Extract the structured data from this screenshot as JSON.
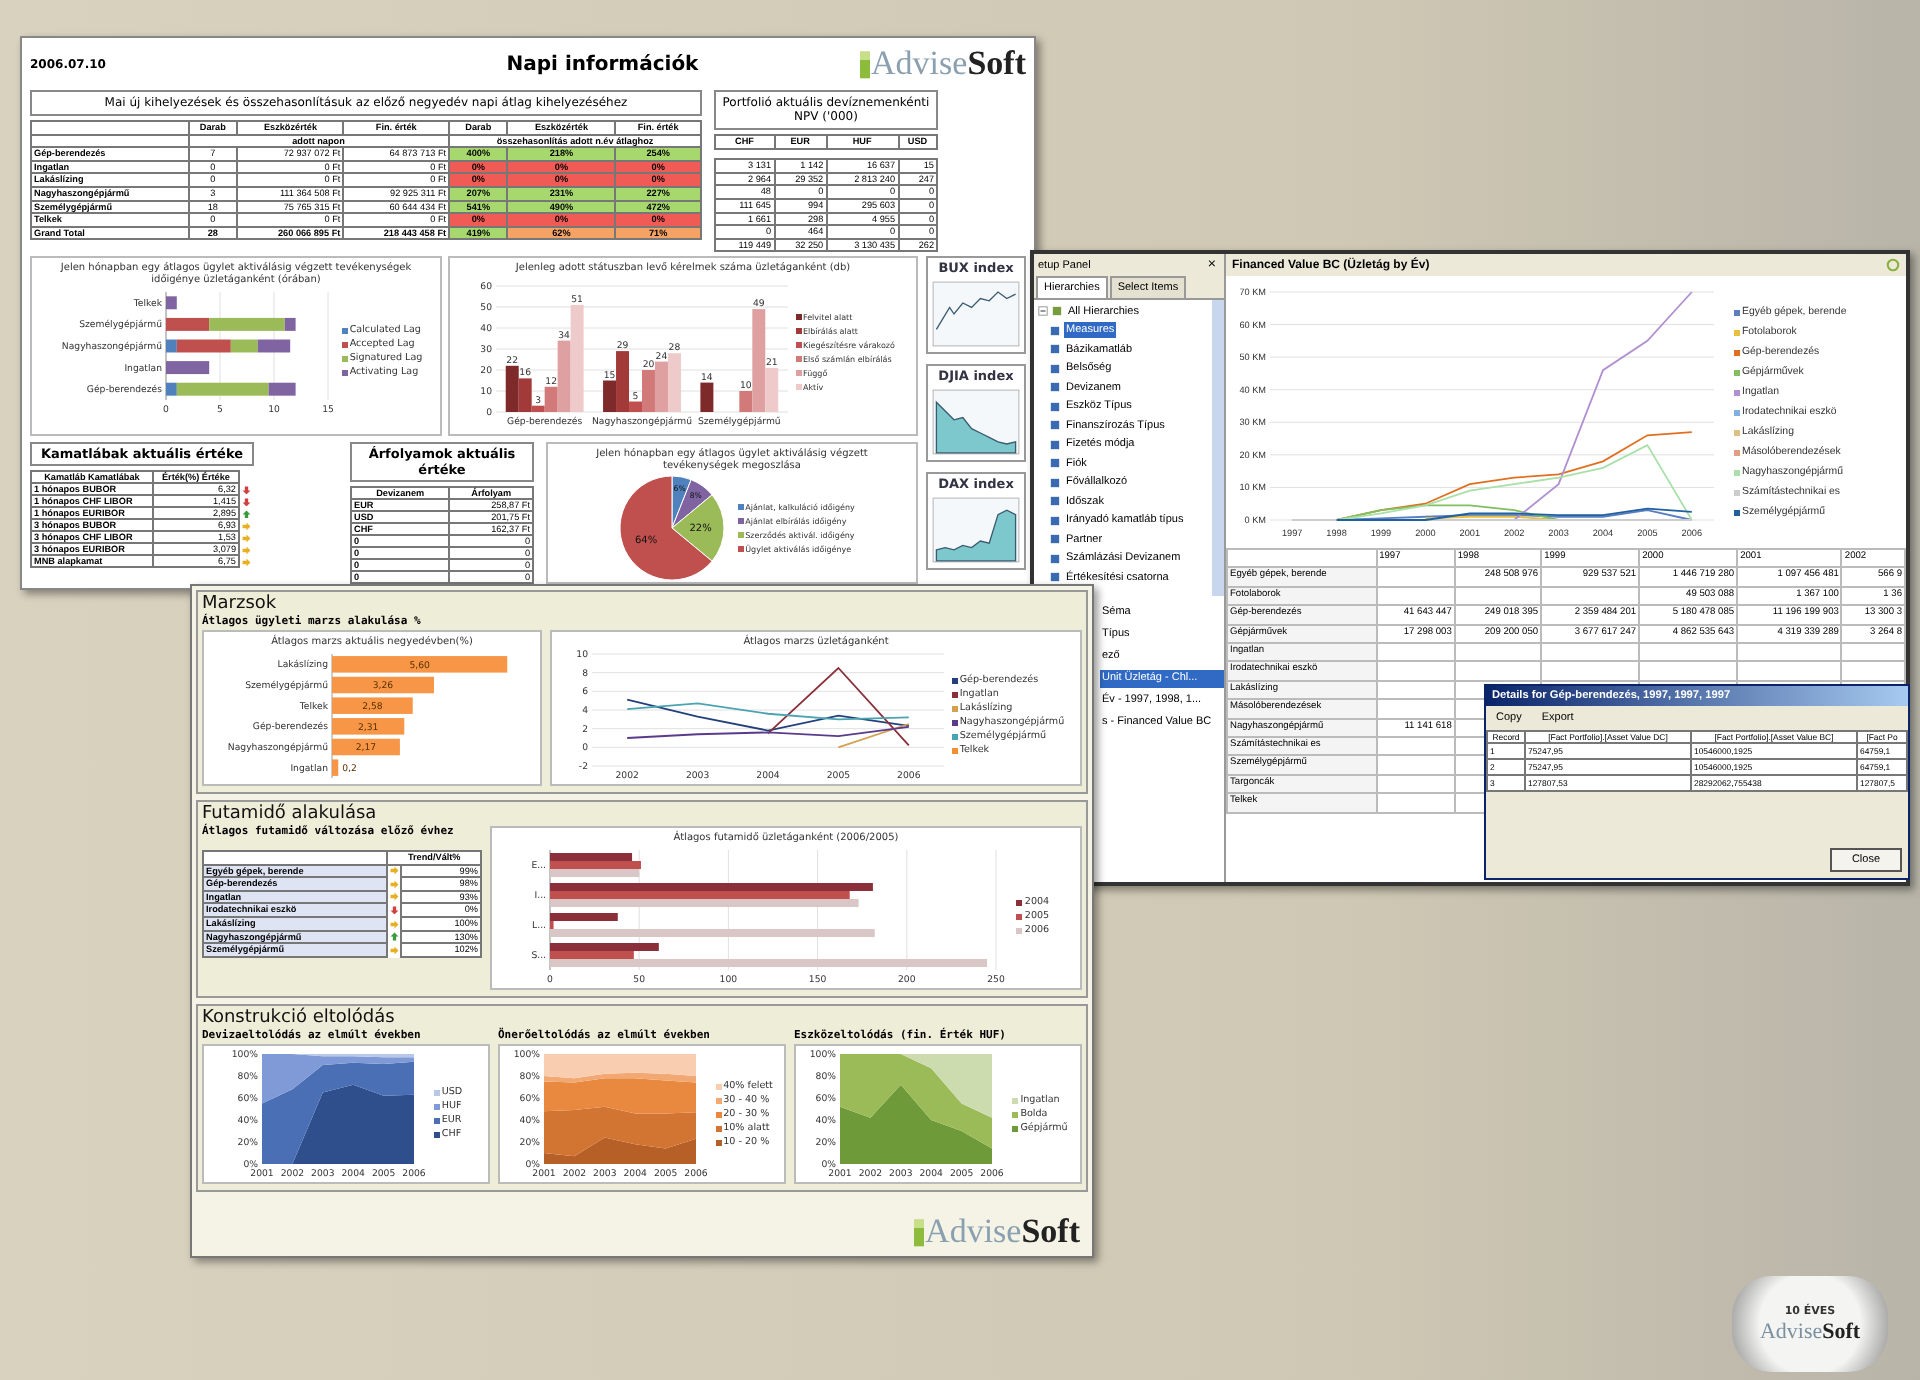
{
  "report": {
    "date": "2006.07.10",
    "title": "Napi információk",
    "logo": "Advise**Soft**",
    "summary": {
      "title": "Mai új kihelyezések és összehasonlításuk az előző negyedév napi átlag kihelyezéséhez",
      "columns": [
        "Darab",
        "Eszközérték",
        "Fin. érték",
        "Darab",
        "Eszközérték",
        "Fin. érték"
      ],
      "groups": [
        "adott napon",
        "összehasonlítás adott n.év átlaghoz"
      ],
      "rows": [
        {
          "label": "Gép-berendezés",
          "kind": "row",
          "count": "7",
          "asset": "72 937 072 Ft",
          "fin": "64 873 713 Ft",
          "compare": [
            {
              "text": "400%",
              "color": "#a6d86e"
            },
            {
              "text": "218%",
              "color": "#a6d86e"
            },
            {
              "text": "254%",
              "color": "#a6d86e"
            }
          ]
        },
        {
          "label": "Ingatlan",
          "kind": "row",
          "count": "0",
          "asset": "0 Ft",
          "fin": "0 Ft",
          "compare": [
            {
              "text": "0%",
              "color": "#f05b55"
            },
            {
              "text": "0%",
              "color": "#f05b55"
            },
            {
              "text": "0%",
              "color": "#f05b55"
            }
          ]
        },
        {
          "label": "Lakáslízing",
          "kind": "row",
          "count": "0",
          "asset": "0 Ft",
          "fin": "0 Ft",
          "compare": [
            {
              "text": "0%",
              "color": "#f05b55"
            },
            {
              "text": "0%",
              "color": "#f05b55"
            },
            {
              "text": "0%",
              "color": "#f05b55"
            }
          ]
        },
        {
          "label": "Nagyhaszongépjármű",
          "kind": "row",
          "count": "3",
          "asset": "111 364 508 Ft",
          "fin": "92 925 311 Ft",
          "compare": [
            {
              "text": "207%",
              "color": "#a6d86e"
            },
            {
              "text": "231%",
              "color": "#a6d86e"
            },
            {
              "text": "227%",
              "color": "#a6d86e"
            }
          ]
        },
        {
          "label": "Személygépjármű",
          "kind": "row",
          "count": "18",
          "asset": "75 765 315 Ft",
          "fin": "60 644 434 Ft",
          "compare": [
            {
              "text": "541%",
              "color": "#a6d86e"
            },
            {
              "text": "490%",
              "color": "#a6d86e"
            },
            {
              "text": "472%",
              "color": "#a6d86e"
            }
          ]
        },
        {
          "label": "Telkek",
          "kind": "row",
          "count": "0",
          "asset": "0 Ft",
          "fin": "0 Ft",
          "compare": [
            {
              "text": "0%",
              "color": "#f05b55"
            },
            {
              "text": "0%",
              "color": "#f05b55"
            },
            {
              "text": "0%",
              "color": "#f05b55"
            }
          ]
        },
        {
          "label": "Grand Total",
          "kind": "total",
          "count": "28",
          "asset": "260 066 895 Ft",
          "fin": "218 443 458 Ft",
          "compare": [
            {
              "text": "419%",
              "color": "#a6d86e"
            },
            {
              "text": "62%",
              "color": "#f5a365"
            },
            {
              "text": "71%",
              "color": "#f5a365"
            }
          ]
        }
      ]
    },
    "npv": {
      "title": "Portfolió aktuális devíznemenkénti NPV ('000)",
      "columns": [
        "CHF",
        "EUR",
        "HUF",
        "USD"
      ],
      "rows": [
        [
          "3 131",
          "1 142",
          "16 637",
          "15"
        ],
        [
          "2 964",
          "29 352",
          "2 813 240",
          "247"
        ],
        [
          "48",
          "0",
          "0",
          "0"
        ],
        [
          "111 645",
          "994",
          "295 603",
          "0"
        ],
        [
          "1 661",
          "298",
          "4 955",
          "0"
        ],
        [
          "0",
          "464",
          "0",
          "0"
        ],
        [
          "119 449",
          "32 250",
          "3 130 435",
          "262"
        ]
      ]
    },
    "lag_chart": {
      "chart_data": {
        "type": "bar",
        "orientation": "horizontal",
        "stacked": true,
        "grid": true,
        "title": "Jelen hónapban egy átlagos ügylet aktiválásig végzett tevékenységek időigénye üzletáganként (órában)",
        "categories": [
          "Telkek",
          "Személygépjármű",
          "Nagyhaszongépjármű",
          "Ingatlan",
          "Gép-berendezés"
        ],
        "xlim": [
          0,
          15
        ],
        "xticks": [
          0,
          5,
          10,
          15
        ],
        "series": [
          {
            "name": "Calculated Lag",
            "color": "#4f81bd",
            "values": [
              0,
              0,
              1,
              0,
              1
            ]
          },
          {
            "name": "Accepted Lag",
            "color": "#c0504d",
            "values": [
              0,
              4,
              5,
              0,
              0
            ]
          },
          {
            "name": "Signatured Lag",
            "color": "#9bbb59",
            "values": [
              0,
              7,
              2.5,
              0,
              8.5
            ]
          },
          {
            "name": "Activating Lag",
            "color": "#8064a2",
            "values": [
              1,
              1,
              3,
              4,
              2.5
            ]
          }
        ]
      }
    },
    "status_chart": {
      "chart_data": {
        "type": "bar",
        "grid": true,
        "title": "Jelenleg adott státuszban levő kérelmek száma üzletáganként (db)",
        "categories": [
          "Gép-berendezés",
          "Nagyhaszongépjármű",
          "Személygépjármű"
        ],
        "ylim": [
          0,
          60
        ],
        "yticks": [
          0,
          10,
          20,
          30,
          40,
          50,
          60
        ],
        "data_labels": true,
        "series": [
          {
            "name": "Felvitel alatt",
            "color": "#7f2a2a",
            "values": [
              22,
              15,
              14
            ]
          },
          {
            "name": "Elbírálás alatt",
            "color": "#a33a3a",
            "values": [
              16,
              29,
              null
            ]
          },
          {
            "name": "Kiegészítésre várakozó",
            "color": "#c05050",
            "values": [
              3,
              5,
              null
            ]
          },
          {
            "name": "Első számlán elbírálás",
            "color": "#d27a7a",
            "values": [
              12,
              20,
              10
            ]
          },
          {
            "name": "Függő",
            "color": "#dea0a0",
            "values": [
              34,
              24,
              49
            ]
          },
          {
            "name": "Aktív",
            "color": "#eecaca",
            "values": [
              51,
              28,
              21
            ]
          }
        ]
      }
    },
    "indices": [
      {
        "title": "BUX index"
      },
      {
        "title": "DJIA index"
      },
      {
        "title": "DAX index"
      }
    ],
    "rates": {
      "title": "Kamatlábak aktuális értéke",
      "columns": [
        "Kamatláb Kamatlábak",
        "Érték(%) Értéke"
      ],
      "rows": [
        {
          "name": "1 hónapos BUBOR",
          "value": "6,32",
          "kind": "down"
        },
        {
          "name": "1 hónapos CHF LIBOR",
          "value": "1,415",
          "kind": "down"
        },
        {
          "name": "1 hónapos EURIBOR",
          "value": "2,895",
          "kind": "up"
        },
        {
          "name": "3 hónapos BUBOR",
          "value": "6,93",
          "kind": "flat"
        },
        {
          "name": "3 hónapos CHF LIBOR",
          "value": "1,53",
          "kind": "flat"
        },
        {
          "name": "3 hónapos EURIBOR",
          "value": "3,079",
          "kind": "flat"
        },
        {
          "name": "MNB alapkamat",
          "value": "6,75",
          "kind": "flat"
        }
      ]
    },
    "fx": {
      "title": "Árfolyamok aktuális értéke",
      "columns": [
        "Devizanem",
        "Árfolyam"
      ],
      "rows": [
        [
          "EUR",
          "258,87 Ft"
        ],
        [
          "USD",
          "201,75 Ft"
        ],
        [
          "CHF",
          "162,37 Ft"
        ],
        [
          "0",
          "0"
        ],
        [
          "0",
          "0"
        ],
        [
          "0",
          "0"
        ],
        [
          "0",
          "0"
        ]
      ]
    },
    "share_chart": {
      "chart_data": {
        "type": "pie",
        "title": "Jelen hónapban egy átlagos ügylet aktiválásig végzett tevékenységek megoszlása",
        "categories": [
          "Ajánlat, kalkuláció időigény",
          "Ajánlat elbírálás időigény",
          "Szerződés aktivál. időigény",
          "Ügylet aktiválás időigénye"
        ],
        "values": [
          6,
          8,
          22,
          64
        ],
        "value_labels": [
          "6%",
          "8%",
          "22%",
          "64%"
        ]
      }
    }
  },
  "margins": {
    "sections": [
      {
        "kind": "margin",
        "title": "Marzsok",
        "subtitle": "Átlagos ügyleti marzs alakulása %",
        "bar_chart": {
          "chart_data": {
            "type": "bar",
            "orientation": "horizontal",
            "title": "Átlagos marzs aktuális negyedévben(%)",
            "categories": [
              "Lakáslízing",
              "Személygépjármű",
              "Telkek",
              "Gép-berendezés",
              "Nagyhaszongépjármű",
              "Ingatlan"
            ],
            "values": [
              5.6,
              3.26,
              2.58,
              2.31,
              2.17,
              0.2
            ],
            "value_labels": [
              "5,60",
              "3,26",
              "2,58",
              "2,31",
              "2,17",
              "0,2"
            ]
          }
        },
        "line_chart": {
          "chart_data": {
            "type": "line",
            "grid": true,
            "title": "Átlagos marzs üzletáganként",
            "x": [
              "2002",
              "2003",
              "2004",
              "2005",
              "2006"
            ],
            "ylim": [
              -2,
              10
            ],
            "yticks": [
              -2,
              0,
              2,
              4,
              6,
              8,
              10
            ],
            "series": [
              {
                "name": "Gép-berendezés",
                "color": "#24407a",
                "values": [
                  5.1,
                  3.3,
                  1.8,
                  3.4,
                  2.3
                ]
              },
              {
                "name": "Ingatlan",
                "color": "#8b2f3a",
                "values": [
                  null,
                  null,
                  1.5,
                  8.5,
                  0.2
                ]
              },
              {
                "name": "Lakáslízing",
                "color": "#d4a050",
                "values": [
                  null,
                  null,
                  null,
                  0,
                  2.5
                ]
              },
              {
                "name": "Nagyhaszongépjármű",
                "color": "#5a3a8a",
                "values": [
                  1,
                  1.4,
                  1.6,
                  1.2,
                  2.2
                ]
              },
              {
                "name": "Személygépjármű",
                "color": "#4aa3b0",
                "values": [
                  4.1,
                  4.7,
                  3.6,
                  3.0,
                  3.2
                ]
              },
              {
                "name": "Telkek",
                "color": "#f09030",
                "values": [
                  null,
                  null,
                  null,
                  null,
                  null
                ]
              }
            ]
          }
        }
      },
      {
        "kind": "term",
        "title": "Futamidő alakulása",
        "subtitle": "Átlagos futamidő változása előző évhez",
        "column": "Trend/Vált%",
        "rows": [
          {
            "name": "Egyéb gépek, berende",
            "value": "99%",
            "kind": "flat"
          },
          {
            "name": "Gép-berendezés",
            "value": "98%",
            "kind": "flat"
          },
          {
            "name": "Ingatlan",
            "value": "93%",
            "kind": "flat"
          },
          {
            "name": "Irodatechnikai eszkö",
            "value": "0%",
            "kind": "down"
          },
          {
            "name": "Lakáslízing",
            "value": "100%",
            "kind": "flat"
          },
          {
            "name": "Nagyhaszongépjármű",
            "value": "130%",
            "kind": "up"
          },
          {
            "name": "Személygépjármű",
            "value": "102%",
            "kind": "flat"
          }
        ],
        "bar_chart": {
          "chart_data": {
            "type": "bar",
            "orientation": "horizontal",
            "grid": true,
            "title": "Átlagos futamidő üzletáganként (2006/2005)",
            "categories": [
              "E...",
              "I...",
              "L...",
              "S..."
            ],
            "xlim": [
              0,
              250
            ],
            "xticks": [
              0,
              50,
              100,
              150,
              200,
              250
            ],
            "series": [
              {
                "name": "2004",
                "color": "#8b2f3a",
                "values": [
                  46,
                  181,
                  38,
                  61
                ]
              },
              {
                "name": "2005",
                "color": "#c0504d",
                "values": [
                  51,
                  168,
                  2,
                  47
                ]
              },
              {
                "name": "2006",
                "color": "#d9c6c6",
                "values": [
                  50,
                  173,
                  182,
                  245
                ]
              }
            ]
          }
        }
      },
      {
        "kind": "shift",
        "title": "Konstrukció eltolódás",
        "charts": [
          {
            "chart_data": {
              "type": "area",
              "stacked": true,
              "title": "Devizaeltolódás az elmúlt években",
              "x": [
                "2001",
                "2002",
                "2003",
                "2004",
                "2005",
                "2006"
              ],
              "ylim": [
                0,
                100
              ],
              "yticks": [
                {
                  "value": 0,
                  "label": "0%"
                },
                {
                  "value": 20,
                  "label": "20%"
                },
                {
                  "value": 40,
                  "label": "40%"
                },
                {
                  "value": 60,
                  "label": "60%"
                },
                {
                  "value": 80,
                  "label": "80%"
                },
                {
                  "value": 100,
                  "label": "100%"
                }
              ],
              "series": [
                {
                  "name": "USD",
                  "color": "#b9c7e8",
                  "values": [
                    0,
                    0,
                    2,
                    2,
                    3,
                    3
                  ]
                },
                {
                  "name": "HUF",
                  "color": "#7f9ad6",
                  "values": [
                    45,
                    32,
                    8,
                    6,
                    6,
                    4
                  ]
                },
                {
                  "name": "EUR",
                  "color": "#4a6fb5",
                  "values": [
                    55,
                    68,
                    25,
                    20,
                    29,
                    30
                  ]
                },
                {
                  "name": "CHF",
                  "color": "#2e4e8c",
                  "values": [
                    0,
                    0,
                    65,
                    72,
                    62,
                    63
                  ]
                }
              ]
            }
          },
          {
            "chart_data": {
              "type": "area",
              "stacked": true,
              "title": "Önerőeltolódás az elmúlt években",
              "x": [
                "2001",
                "2002",
                "2003",
                "2004",
                "2005",
                "2006"
              ],
              "ylim": [
                0,
                100
              ],
              "yticks": [
                {
                  "value": 0,
                  "label": "0%"
                },
                {
                  "value": 20,
                  "label": "20%"
                },
                {
                  "value": 40,
                  "label": "40%"
                },
                {
                  "value": 60,
                  "label": "60%"
                },
                {
                  "value": 80,
                  "label": "80%"
                },
                {
                  "value": 100,
                  "label": "100%"
                }
              ],
              "series": [
                {
                  "name": "40% felett",
                  "color": "#f8cdb0",
                  "values": [
                    20,
                    22,
                    18,
                    17,
                    18,
                    20
                  ]
                },
                {
                  "name": "30 - 40 %",
                  "color": "#f2a872",
                  "values": [
                    5,
                    4,
                    4,
                    5,
                    6,
                    6
                  ]
                },
                {
                  "name": "20 - 30 %",
                  "color": "#e8893f",
                  "values": [
                    27,
                    25,
                    26,
                    32,
                    30,
                    27
                  ]
                },
                {
                  "name": "10% alatt",
                  "color": "#d27432",
                  "values": [
                    38,
                    42,
                    28,
                    28,
                    32,
                    24
                  ]
                },
                {
                  "name": "10 - 20 %",
                  "color": "#b65f26",
                  "values": [
                    10,
                    7,
                    24,
                    18,
                    14,
                    23
                  ]
                }
              ]
            }
          },
          {
            "chart_data": {
              "type": "area",
              "stacked": true,
              "title": "Eszközeltolódás (fin. Érték HUF)",
              "x": [
                "2001",
                "2002",
                "2003",
                "2004",
                "2005",
                "2006"
              ],
              "ylim": [
                0,
                100
              ],
              "yticks": [
                {
                  "value": 0,
                  "label": "0%"
                },
                {
                  "value": 20,
                  "label": "20%"
                },
                {
                  "value": 40,
                  "label": "40%"
                },
                {
                  "value": 60,
                  "label": "60%"
                },
                {
                  "value": 80,
                  "label": "80%"
                },
                {
                  "value": 100,
                  "label": "100%"
                }
              ],
              "series": [
                {
                  "name": "Ingatlan",
                  "color": "#cddcaf",
                  "values": [
                    0,
                    0,
                    0,
                    13,
                    45,
                    58
                  ]
                },
                {
                  "name": "Bolda",
                  "color": "#9bbb59",
                  "values": [
                    48,
                    58,
                    28,
                    47,
                    25,
                    28
                  ]
                },
                {
                  "name": "Gépjármű",
                  "color": "#6f9a3a",
                  "values": [
                    52,
                    42,
                    72,
                    40,
                    30,
                    14
                  ]
                }
              ]
            }
          }
        ]
      }
    ],
    "logo": "Advise**Soft**"
  },
  "app": {
    "panel": {
      "title": "etup Panel",
      "close": "×",
      "tabs": [
        {
          "label": "Hierarchies",
          "selected": true
        },
        {
          "label": "Select Items",
          "selected": false
        }
      ],
      "tree": [
        {
          "label": "All Hierarchies",
          "expanded": true,
          "selected": false,
          "children": [
            {
              "label": "Measures",
              "selected": true
            },
            {
              "label": "Bázikamatláb",
              "selected": false
            },
            {
              "label": "Belsőség",
              "selected": false
            },
            {
              "label": "Devizanem",
              "selected": false
            },
            {
              "label": "Eszköz Típus",
              "selected": false
            },
            {
              "label": "Finanszírozás Típus",
              "selected": false
            },
            {
              "label": "Fizetés módja",
              "selected": false
            },
            {
              "label": "Fiók",
              "selected": false
            },
            {
              "label": "Fővállalkozó",
              "selected": false
            },
            {
              "label": "Időszak",
              "selected": false
            },
            {
              "label": "Irányadó kamatláb típus",
              "selected": false
            },
            {
              "label": "Partner",
              "selected": false
            },
            {
              "label": "Számlázási Devizanem",
              "selected": false
            },
            {
              "label": "Értékesítési csatorna",
              "selected": false
            }
          ]
        }
      ],
      "lower_items": [
        {
          "label": "Séma",
          "selected": false
        },
        {
          "label": "Típus",
          "selected": false
        },
        {
          "label": "ező",
          "selected": false
        },
        {
          "label": "Unit Üzletág - Chl...",
          "selected": true
        },
        {
          "label": "Év - 1997, 1998, 1...",
          "selected": false
        },
        {
          "label": "s - Financed Value BC",
          "selected": false
        }
      ]
    },
    "chart": {
      "title": "Financed Value BC (Üzletág by Év)",
      "chart_data": {
        "type": "line",
        "grid": true,
        "x": [
          "1997",
          "1998",
          "1999",
          "2000",
          "2001",
          "2002",
          "2003",
          "2004",
          "2005",
          "2006"
        ],
        "ylim": [
          0,
          70
        ],
        "yticks": [
          {
            "value": 0,
            "label": "0 KM"
          },
          {
            "value": 10,
            "label": "10 KM"
          },
          {
            "value": 20,
            "label": "20 KM"
          },
          {
            "value": 30,
            "label": "30 KM"
          },
          {
            "value": 40,
            "label": "40 KM"
          },
          {
            "value": 50,
            "label": "50 KM"
          },
          {
            "value": 60,
            "label": "60 KM"
          },
          {
            "value": 70,
            "label": "70 KM"
          }
        ],
        "series": [
          {
            "name": "Egyéb gépek, berende",
            "color": "#5a7fc0",
            "values": [
              null,
              0,
              0.5,
              1,
              1.5,
              1.5,
              1,
              1,
              3,
              0
            ]
          },
          {
            "name": "Fotolaborok",
            "color": "#e8c040",
            "values": [
              null,
              null,
              null,
              0.5,
              1,
              1,
              0,
              0,
              null,
              null
            ]
          },
          {
            "name": "Gép-berendezés",
            "color": "#e07020",
            "values": [
              null,
              0,
              3,
              5,
              11,
              13,
              14,
              18,
              26,
              27
            ]
          },
          {
            "name": "Gépjárművek",
            "color": "#80c060",
            "values": [
              null,
              0,
              3,
              4.5,
              4.5,
              3,
              0,
              0,
              0,
              0
            ]
          },
          {
            "name": "Ingatlan",
            "color": "#b090d0",
            "values": [
              null,
              null,
              null,
              null,
              null,
              0,
              11,
              46,
              55,
              70
            ]
          },
          {
            "name": "Irodatechnikai eszkö",
            "color": "#80b0e0",
            "values": [
              null,
              null,
              null,
              null,
              null,
              null,
              null,
              null,
              null,
              null
            ]
          },
          {
            "name": "Lakáslízing",
            "color": "#e0c080",
            "values": [
              null,
              null,
              null,
              null,
              null,
              null,
              null,
              null,
              null,
              null
            ]
          },
          {
            "name": "Másolóberendezések",
            "color": "#e0a080",
            "values": [
              null,
              null,
              null,
              null,
              null,
              null,
              null,
              null,
              null,
              null
            ]
          },
          {
            "name": "Nagyhaszongépjármű",
            "color": "#a8e0a8",
            "values": [
              null,
              0,
              2,
              4.5,
              9,
              11,
              13,
              16,
              23,
              0
            ]
          },
          {
            "name": "Számítástechnikai es",
            "color": "#cccccc",
            "values": [
              0,
              0,
              0,
              0,
              0,
              0,
              0,
              0,
              0,
              0
            ]
          },
          {
            "name": "Személygépjármű",
            "color": "#2060a0",
            "values": [
              null,
              0,
              0,
              0,
              2,
              2,
              1.5,
              1.5,
              3.5,
              2.5
            ]
          }
        ]
      }
    },
    "table": {
      "columns": [
        "1997",
        "1998",
        "1999",
        "2000",
        "2001",
        "2002"
      ],
      "rows": [
        {
          "label": "Egyéb gépek, berende",
          "cells": [
            "",
            "248 508 976",
            "929 537 521",
            "1 446 719 280",
            "1 097 456 481",
            "566 9"
          ]
        },
        {
          "label": "Fotolaborok",
          "cells": [
            "",
            "",
            "",
            "49 503 088",
            "1 367 100",
            "1 36"
          ]
        },
        {
          "label": "Gép-berendezés",
          "cells": [
            "41 643 447",
            "249 018 395",
            "2 359 484 201",
            "5 180 478 085",
            "11 196 199 903",
            "13 300 3"
          ]
        },
        {
          "label": "Gépjárművek",
          "cells": [
            "17 298 003",
            "209 200 050",
            "3 677 617 247",
            "4 862 535 643",
            "4 319 339 289",
            "3 264 8"
          ]
        },
        {
          "label": "Ingatlan",
          "cells": [
            "",
            "",
            "",
            "",
            "",
            ""
          ]
        },
        {
          "label": "Irodatechnikai eszkö",
          "cells": [
            "",
            "",
            "",
            "",
            "",
            ""
          ]
        },
        {
          "label": "Lakáslízing",
          "cells": [
            "",
            "",
            "",
            "",
            "",
            ""
          ]
        },
        {
          "label": "Másolóberendezések",
          "cells": [
            "",
            "",
            "",
            "",
            "",
            ""
          ]
        },
        {
          "label": "Nagyhaszongépjármű",
          "cells": [
            "11 141 618",
            "",
            "",
            "",
            "",
            ""
          ]
        },
        {
          "label": "Számítástechnikai es",
          "cells": [
            "",
            "",
            "",
            "",
            "",
            ""
          ]
        },
        {
          "label": "Személygépjármű",
          "cells": [
            "",
            "",
            "",
            "",
            "",
            ""
          ]
        },
        {
          "label": "Targoncák",
          "cells": [
            "",
            "",
            "",
            "",
            "",
            ""
          ]
        },
        {
          "label": "Telkek",
          "cells": [
            "",
            "",
            "",
            "",
            "",
            ""
          ]
        }
      ]
    },
    "dialog": {
      "title": "Details for Gép-berendezés, 1997, 1997, 1997",
      "tools": [
        "Copy",
        "Export"
      ],
      "columns": [
        "Record",
        "[Fact Portfolio].[Asset Value DC]",
        "[Fact Portfolio].[Asset Value BC]",
        "[Fact Po"
      ],
      "rows": [
        [
          "1",
          "75247,95",
          "10546000,1925",
          "64759,1"
        ],
        [
          "2",
          "75247,95",
          "10546000,1925",
          "64759,1"
        ],
        [
          "3",
          "127807,53",
          "28292062,755438",
          "127807,5"
        ]
      ],
      "close": "Close"
    }
  },
  "badge": {
    "caption": "10 ÉVES",
    "logo": "Advise**Soft**"
  }
}
